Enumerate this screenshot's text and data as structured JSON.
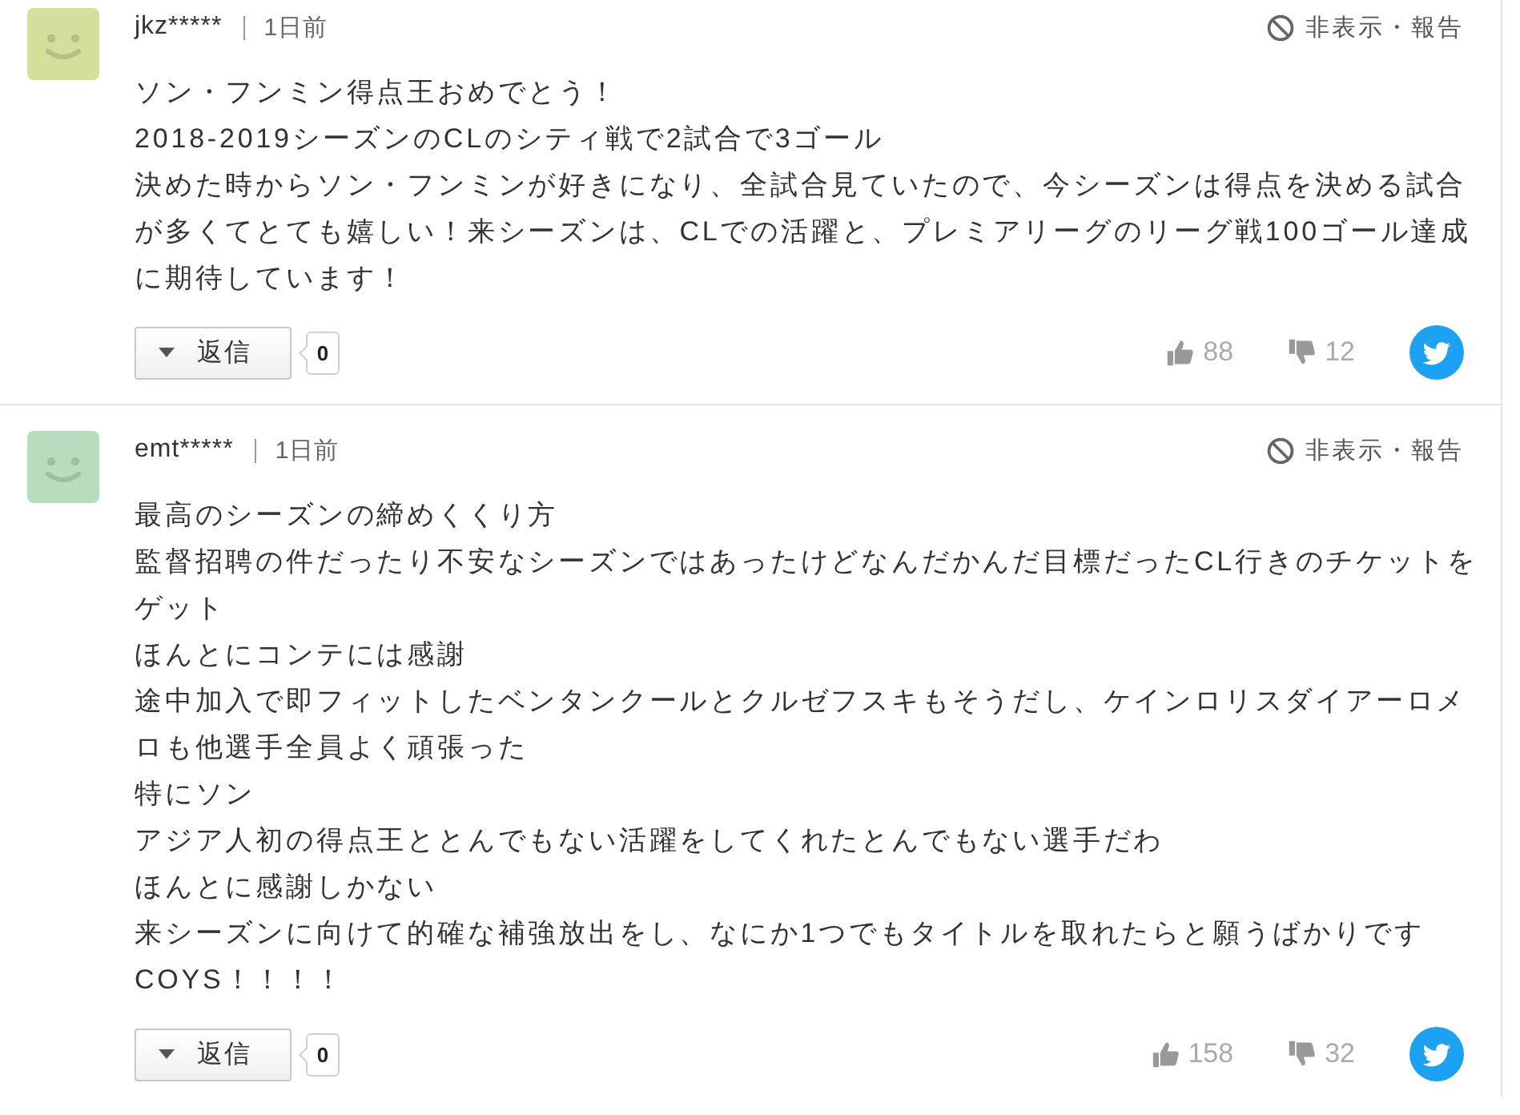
{
  "comments": [
    {
      "avatar": {
        "color": "#d4df9c"
      },
      "user": "jkz*****",
      "time": "1日前",
      "hide_report": "非表示・報告",
      "body": [
        "ソン・フンミン得点王おめでとう！",
        "2018-2019シーズンのCLのシティ戦で2試合で3ゴール",
        "決めた時からソン・フンミンが好きになり、全試合見ていたので、今シーズンは得点を決める試合が多くてとても嬉しい！来シーズンは、CLでの活躍と、プレミアリーグのリーグ戦100ゴール達成に期待しています！"
      ],
      "reply": {
        "label": "返信",
        "count": "0"
      },
      "likes": "88",
      "dislikes": "12"
    },
    {
      "avatar": {
        "color": "#b7dfbf"
      },
      "user": "emt*****",
      "time": "1日前",
      "hide_report": "非表示・報告",
      "body": [
        "最高のシーズンの締めくくり方",
        "監督招聘の件だったり不安なシーズンではあったけどなんだかんだ目標だったCL行きのチケットをゲット",
        "ほんとにコンテには感謝",
        "途中加入で即フィットしたベンタンクールとクルゼフスキもそうだし、ケインロリスダイアーロメロも他選手全員よく頑張った",
        "特にソン",
        "アジア人初の得点王ととんでもない活躍をしてくれたとんでもない選手だわ",
        "ほんとに感謝しかない",
        "来シーズンに向けて的確な補強放出をし、なにか1つでもタイトルを取れたらと願うばかりです",
        "COYS！！！！"
      ],
      "reply": {
        "label": "返信",
        "count": "0"
      },
      "likes": "158",
      "dislikes": "32"
    }
  ]
}
